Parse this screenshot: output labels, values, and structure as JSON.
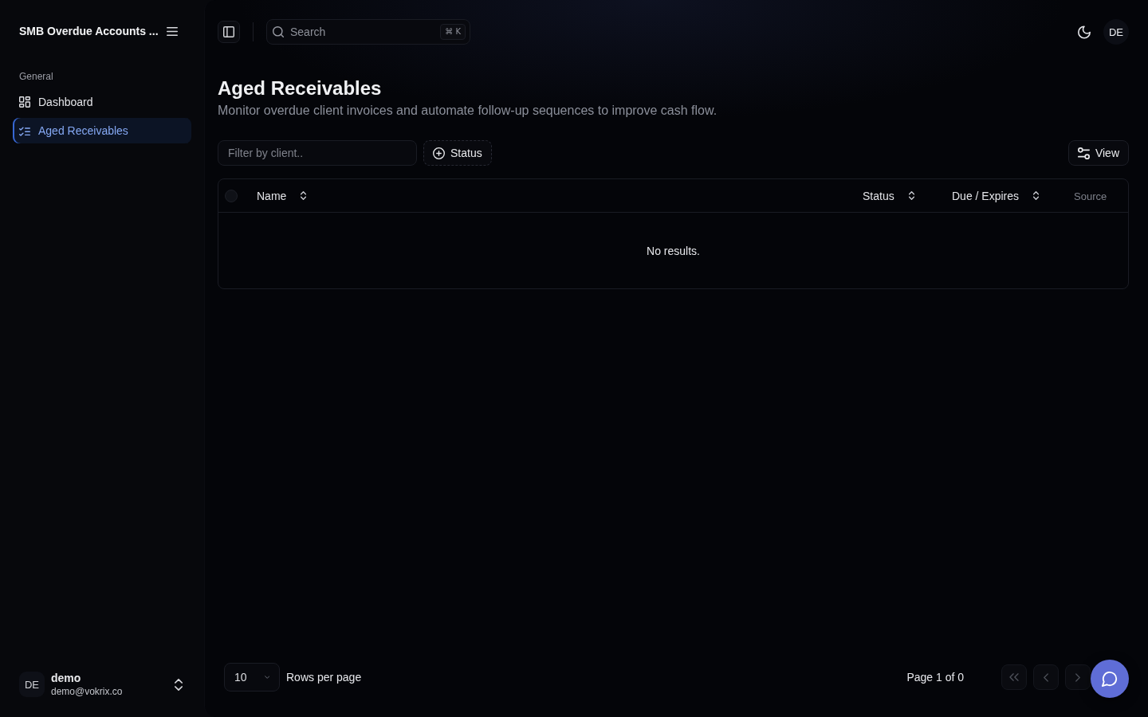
{
  "sidebar": {
    "workspace": "SMB Overdue Accounts ...",
    "section": "General",
    "items": [
      {
        "label": "Dashboard",
        "selected": false
      },
      {
        "label": "Aged Receivables",
        "selected": true
      }
    ],
    "user": {
      "initials": "DE",
      "name": "demo",
      "email": "demo@vokrix.co"
    }
  },
  "topbar": {
    "search": {
      "placeholder": "Search",
      "shortcut": "⌘ K"
    },
    "avatar": "DE"
  },
  "page": {
    "title": "Aged Receivables",
    "subtitle": "Monitor overdue client invoices and automate follow-up sequences to improve cash flow."
  },
  "toolbar": {
    "filter": {
      "placeholder": "Filter by client.."
    },
    "status_button": "Status",
    "view_button": "View"
  },
  "table": {
    "select_all": {
      "checked": false
    },
    "columns": [
      {
        "label": "Name",
        "sortable": true
      },
      {
        "label": "Status",
        "sortable": true
      },
      {
        "label": "Due / Expires",
        "sortable": true
      },
      {
        "label": "Source",
        "sortable": false
      }
    ],
    "empty_message": "No results."
  },
  "pagination": {
    "rows_per_page": "10",
    "rows_label": "Rows per page",
    "page_label": "Page 1 of 0",
    "buttons": [
      {
        "kind": "first",
        "disabled": true
      },
      {
        "kind": "prev",
        "disabled": true
      },
      {
        "kind": "next",
        "disabled": true
      }
    ]
  }
}
